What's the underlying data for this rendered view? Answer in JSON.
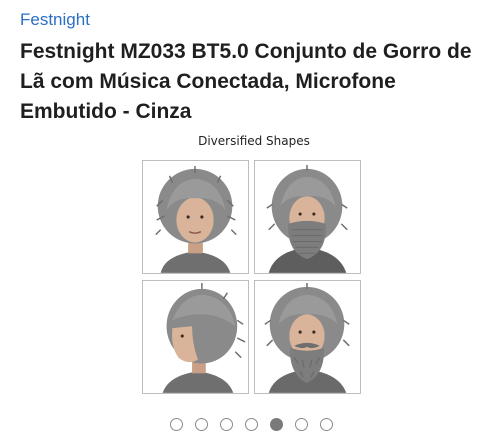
{
  "header": {
    "brand": "Festnight",
    "title": "Festnight MZ033 BT5.0 Conjunto de Gorro de Lã com Música Conectada, Microfone Embutido - Cinza"
  },
  "gallery": {
    "caption": "Diversified Shapes",
    "images": [
      {
        "name": "wig-hat-front",
        "mustache": false,
        "beard": false
      },
      {
        "name": "wig-hat-beard-mask",
        "mustache": false,
        "beard": true
      },
      {
        "name": "wig-hat-side",
        "mustache": false,
        "beard": false
      },
      {
        "name": "wig-hat-beard",
        "mustache": true,
        "beard": true
      }
    ],
    "carousel": {
      "total": 7,
      "active_index": 4
    }
  },
  "colors": {
    "brand": "#2a6fc4",
    "title": "#1f1f1f",
    "yarn": "#8a8a8a",
    "skin": "#d9b49a",
    "dot_active": "#7a7a7a"
  }
}
